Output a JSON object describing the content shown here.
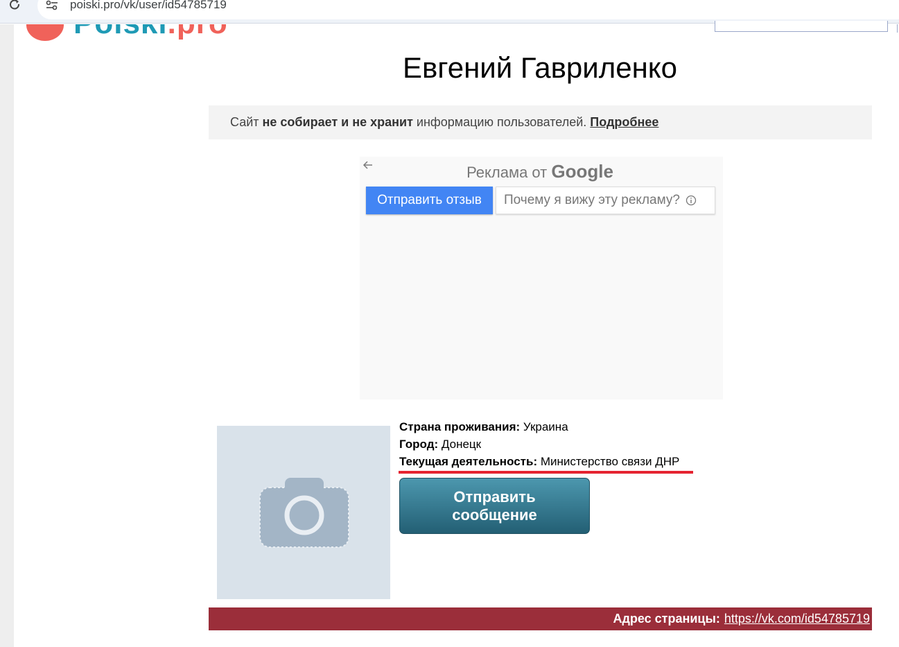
{
  "browser": {
    "url": "poiski.pro/vk/user/id54785719"
  },
  "logo": {
    "part1": "Poiski",
    "part2": ".pro"
  },
  "profile": {
    "name": "Евгений Гавриленко"
  },
  "notice": {
    "prefix": "Сайт ",
    "bold": "не собирает и не хранит",
    "suffix": " информацию пользователей. ",
    "link": "Подробнее"
  },
  "ad": {
    "header_prefix": "Реклама от ",
    "header_brand": "Google",
    "feedback_button": "Отправить отзыв",
    "why_button": "Почему я вижу эту рекламу?"
  },
  "details": {
    "country_label": "Страна проживания:",
    "country_value": "Украина",
    "city_label": "Город:",
    "city_value": "Донецк",
    "activity_label": "Текущая деятельность:",
    "activity_value": "Министерство связи ДНР"
  },
  "actions": {
    "send_message_line1": "Отправить",
    "send_message_line2": "сообщение"
  },
  "footer": {
    "address_label": "Адрес страницы:",
    "address_link": "https://vk.com/id54785719"
  },
  "colors": {
    "accent_red": "#e52431",
    "footer_bg": "#9b2e3a",
    "button_teal": "#2e7186",
    "ad_blue": "#4285f4"
  }
}
